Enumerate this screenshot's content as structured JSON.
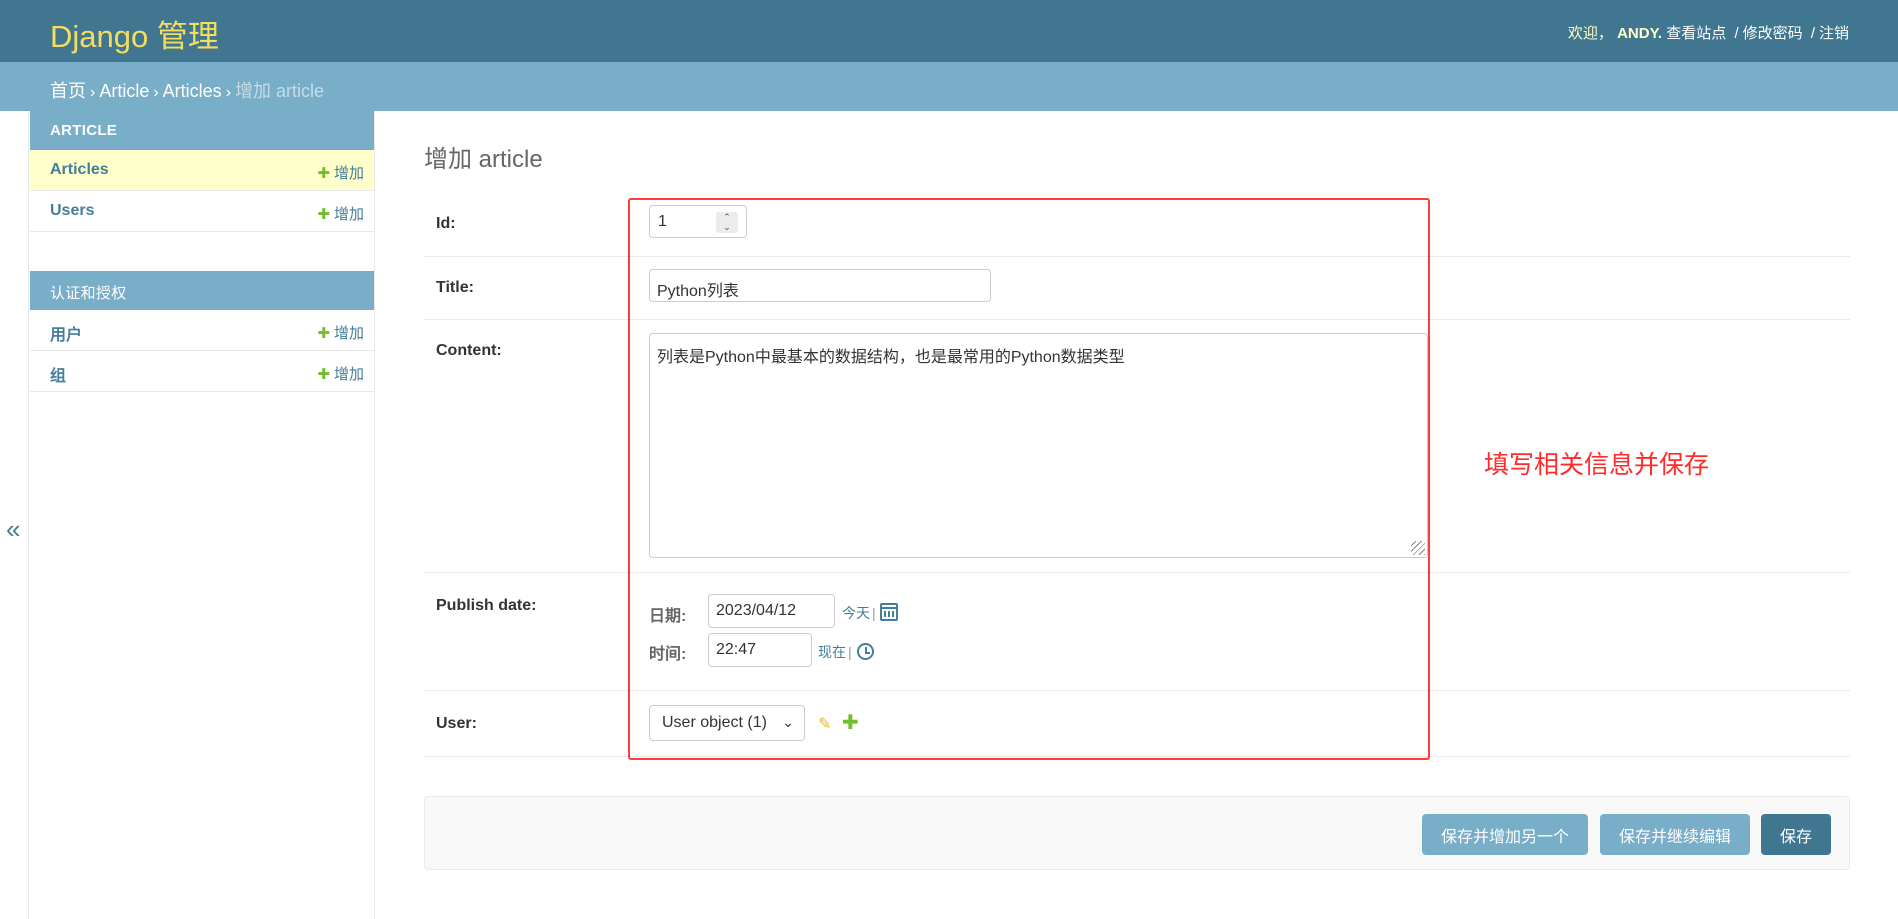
{
  "header": {
    "brand": "Django 管理",
    "welcome": "欢迎，",
    "username": "ANDY.",
    "view_site": "查看站点",
    "sep": "/",
    "change_password": "修改密码",
    "logout": "注销"
  },
  "breadcrumbs": {
    "home": "首页",
    "app": "Article",
    "model": "Articles",
    "current": "增加 article",
    "arrow": "›"
  },
  "sidebar": {
    "toggle": "«",
    "modules": [
      {
        "caption": "ARTICLE",
        "models": [
          {
            "name": "Articles",
            "add": "增加"
          },
          {
            "name": "Users",
            "add": "增加"
          }
        ]
      },
      {
        "caption": "认证和授权",
        "models": [
          {
            "name": "用户",
            "add": "增加"
          },
          {
            "name": "组",
            "add": "增加"
          }
        ]
      }
    ],
    "plus": "✚"
  },
  "form": {
    "title": "增加 article",
    "id_label": "Id:",
    "id_value": "1",
    "title_label": "Title:",
    "title_value": "Python列表",
    "content_label": "Content:",
    "content_value": "列表是Python中最基本的数据结构，也是最常用的Python数据类型",
    "publish_label": "Publish date:",
    "date_label": "日期:",
    "date_value": "2023/04/12",
    "today": "今天",
    "time_label": "时间:",
    "time_value": "22:47",
    "now": "现在",
    "shortcut_sep": "|",
    "user_label": "User:",
    "user_value": "User object (1)",
    "spin_up": "⌃",
    "spin_down": "⌄",
    "chevron": "⌄",
    "pencil": "✎",
    "add_plus": "✚"
  },
  "annotation": "填写相关信息并保存",
  "buttons": {
    "save_add_another": "保存并增加另一个",
    "save_continue": "保存并继续编辑",
    "save": "保存"
  },
  "colors": {
    "header_bg": "#417690",
    "brand": "#f5dd5d",
    "breadcrumb_bg": "#79aec8",
    "selected_row": "#ffffcc",
    "highlight_border": "#ff3b3b",
    "annotation": "#ff2a2a"
  }
}
